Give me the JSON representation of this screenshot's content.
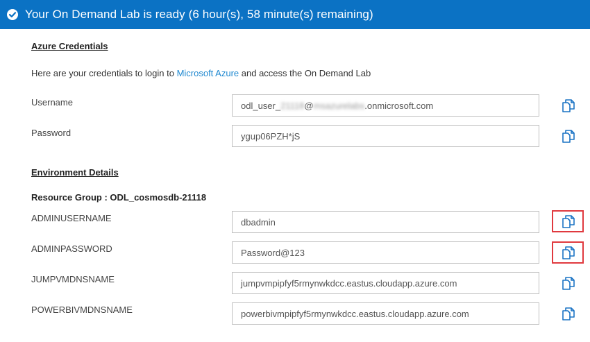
{
  "banner": {
    "title": "Your On Demand Lab is ready (6 hour(s), 58 minute(s) remaining)"
  },
  "credentials": {
    "heading": "Azure Credentials",
    "intro_prefix": "Here are your credentials to login to ",
    "intro_link": "Microsoft Azure",
    "intro_suffix": " and access the On Demand Lab",
    "username": {
      "label": "Username",
      "value_prefix": "odl_user_",
      "value_blur1": "21118",
      "value_at": "@",
      "value_blur2": "msazurelabs",
      "value_suffix": ".onmicrosoft.com"
    },
    "password": {
      "label": "Password",
      "value": "ygup06PZH*jS"
    }
  },
  "environment": {
    "heading": "Environment Details",
    "resource_group": "Resource Group : ODL_cosmosdb-21118",
    "fields": [
      {
        "label": "ADMINUSERNAME",
        "value": "dbadmin",
        "highlighted": true
      },
      {
        "label": "ADMINPASSWORD",
        "value": "Password@123",
        "highlighted": true
      },
      {
        "label": "JUMPVMDNSNAME",
        "value": "jumpvmpipfyf5rmynwkdcc.eastus.cloudapp.azure.com",
        "highlighted": false
      },
      {
        "label": "POWERBIVMDNSNAME",
        "value": "powerbivmpipfyf5rmynwkdcc.eastus.cloudapp.azure.com",
        "highlighted": false
      }
    ]
  },
  "icons": {
    "banner": "check-circle-icon",
    "copy": "copy-icon"
  },
  "colors": {
    "banner": "#0b72c4",
    "link": "#1e88d0",
    "copy_icon": "#1a73c4",
    "highlight": "#e0393e"
  }
}
